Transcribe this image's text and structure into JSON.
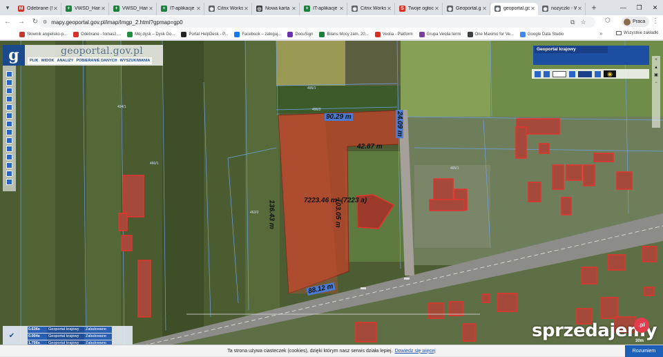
{
  "browser": {
    "tabs": [
      {
        "title": "Odebrane (!",
        "icon": "gmail-icon",
        "color": "#d93025",
        "glyph": "M",
        "active": false
      },
      {
        "title": "VWSD_Harm",
        "icon": "sheets-icon",
        "color": "#188038",
        "glyph": "+",
        "active": false
      },
      {
        "title": "VWSD_Harm",
        "icon": "sheets-icon",
        "color": "#188038",
        "glyph": "+",
        "active": false
      },
      {
        "title": "IT-aplikacje",
        "icon": "sheets-icon",
        "color": "#188038",
        "glyph": "+",
        "active": false
      },
      {
        "title": "Citrix Works",
        "icon": "globe-icon",
        "color": "#5f6368",
        "glyph": "◉",
        "active": false
      },
      {
        "title": "Nowa karta",
        "icon": "newtab-icon",
        "color": "#3c4043",
        "glyph": "◎",
        "active": false
      },
      {
        "title": "IT-aplikacje",
        "icon": "sheets-icon",
        "color": "#188038",
        "glyph": "+",
        "active": false
      },
      {
        "title": "Citrix Works",
        "icon": "globe-icon",
        "color": "#5f6368",
        "glyph": "◉",
        "active": false
      },
      {
        "title": "Twoje ogłoc",
        "icon": "sprzedajemy-icon",
        "color": "#d93025",
        "glyph": "S",
        "active": false
      },
      {
        "title": "Geoportal.gc",
        "icon": "globe-icon",
        "color": "#5f6368",
        "glyph": "◉",
        "active": false
      },
      {
        "title": "geoportal.gc",
        "icon": "globe-icon",
        "color": "#5f6368",
        "glyph": "◉",
        "active": true
      },
      {
        "title": "nozyczki - W",
        "icon": "globe-icon",
        "color": "#5f6368",
        "glyph": "◉",
        "active": false
      }
    ],
    "new_tab": "+",
    "close_glyph": "✕",
    "url": "mapy.geoportal.gov.pl/imap/Imgp_2.html?gpmap=gp0",
    "profile_label": "Praca",
    "bookmarks": [
      {
        "label": "Słownik angielsko-p...",
        "color": "#c0392b"
      },
      {
        "label": "Odebrane - tomasz....",
        "color": "#d93025"
      },
      {
        "label": "Mój dysk – Dysk Go...",
        "color": "#1e8e3e"
      },
      {
        "label": "Portal HelpDesk - P...",
        "color": "#222222"
      },
      {
        "label": "Facebook – zaloguj...",
        "color": "#1877f2"
      },
      {
        "label": "DocuSign",
        "color": "#6b2fb3"
      },
      {
        "label": "Bilans Mocy zam. 20...",
        "color": "#188038"
      },
      {
        "label": "Veolia - Platform",
        "color": "#d93025"
      },
      {
        "label": "Grupa Veolia termi",
        "color": "#7b3fa0"
      },
      {
        "label": "One Maximo for Ve...",
        "color": "#3c4043"
      },
      {
        "label": "Google Data Studio",
        "color": "#4285f4"
      }
    ],
    "bookmarks_more": "»",
    "other_bookmarks": "Wszystkie zakładki"
  },
  "geoportal": {
    "title": "geoportal.gov.pl",
    "menu": [
      "PLIK",
      "WIDOK",
      "ANALIZY",
      "POBIERANIE DANYCH",
      "WYSZUKIWANIA"
    ],
    "layer_label": "Geoportal krajowy"
  },
  "measurements": {
    "top": "90.29 m",
    "right_top": "24.09 m",
    "inner_top": "42.87 m",
    "left": "136.43 m",
    "area": "7223.46 m² (7223 a)",
    "inner_vertical": "103.05 m",
    "bottom": "88.12 m"
  },
  "parcel_ids": [
    "495/1",
    "496/2",
    "463/2",
    "465/1",
    "494/1",
    "460/1"
  ],
  "status": {
    "rows": [
      {
        "value": "0.636s",
        "name": "Geoportal krajowy",
        "state": "Załadowano"
      },
      {
        "value": "0.004s",
        "name": "Geoportal krajowy",
        "state": "Załadowano"
      },
      {
        "value": "1.756s",
        "name": "Geoportal krajowy",
        "state": "Załadowano"
      }
    ]
  },
  "watermark": {
    "text": "sprzedajemy",
    "badge": ".pl"
  },
  "scale": "30m",
  "cookie": {
    "text": "Ta strona używa ciasteczek (cookies), dzięki którym nasz serwis działa lepiej.",
    "link": "Dowiedz się więcej",
    "button": "Rozumiem"
  },
  "colors": {
    "accent": "#1c5fb8",
    "parcel_fill": "#b5452b",
    "building_outline": "#e5322c",
    "parcel_line": "#6fa3e8"
  }
}
